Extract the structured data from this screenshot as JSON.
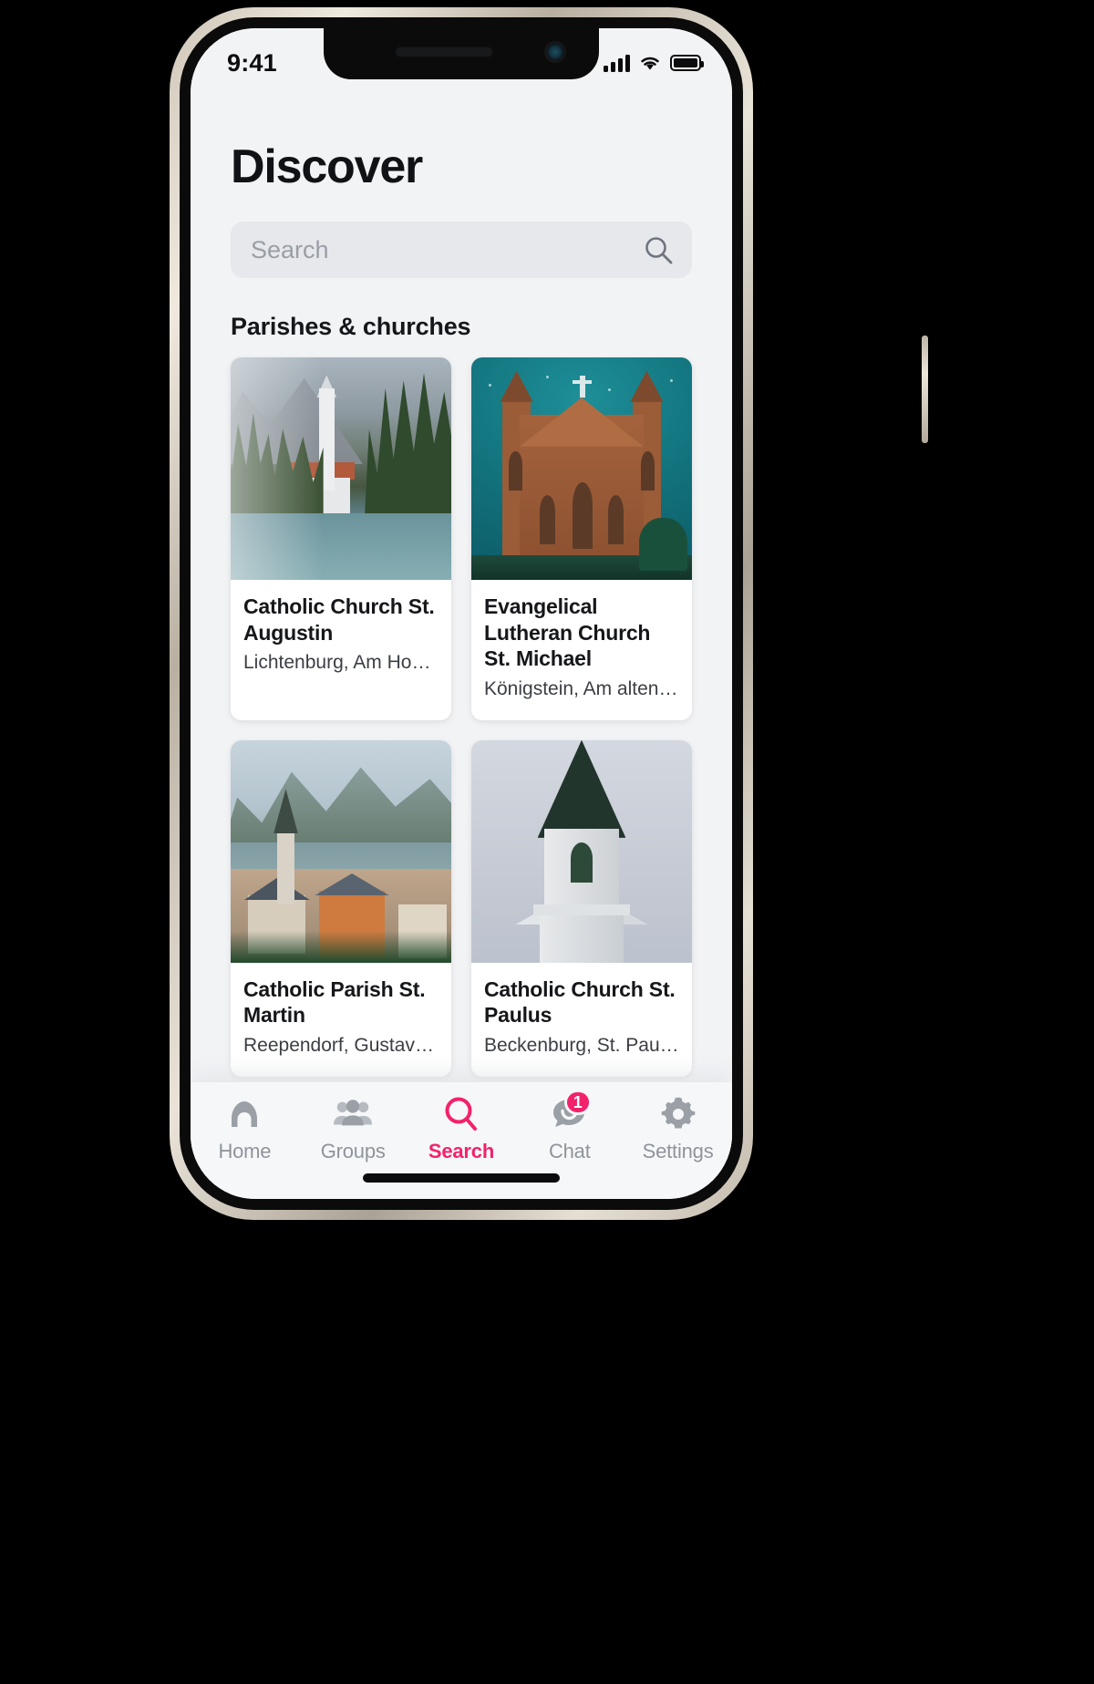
{
  "status_bar": {
    "time": "9:41",
    "signal_icon": "cellular-signal-icon",
    "wifi_icon": "wifi-icon",
    "battery_icon": "battery-full-icon"
  },
  "header": {
    "title": "Discover"
  },
  "search": {
    "value": "",
    "placeholder": "Search",
    "icon": "search-icon"
  },
  "sections": [
    {
      "title": "Parishes & churches",
      "cards": [
        {
          "title": "Catholic Church St. Augustin",
          "subtitle": "Lichtenburg, Am Hohenst…",
          "photo": "lake-church-photo"
        },
        {
          "title": "Evangelical Lutheran Church St. Michael",
          "subtitle": "Königstein, Am alten …",
          "photo": "gothic-church-photo"
        },
        {
          "title": "Catholic Parish St. Martin",
          "subtitle": "Reependorf, Gustav-…",
          "photo": "alpine-village-photo"
        },
        {
          "title": "Catholic Church St. Paulus",
          "subtitle": "Beckenburg, St. Paulus…",
          "photo": "white-steeple-photo"
        },
        {
          "title": "",
          "subtitle": "",
          "photo": "partial-card-photo-left"
        },
        {
          "title": "",
          "subtitle": "",
          "photo": "partial-card-photo-right"
        }
      ]
    }
  ],
  "tabbar": {
    "items": [
      {
        "label": "Home",
        "icon": "home-icon",
        "active": false,
        "badge": ""
      },
      {
        "label": "Groups",
        "icon": "groups-icon",
        "active": false,
        "badge": ""
      },
      {
        "label": "Search",
        "icon": "search-icon",
        "active": true,
        "badge": ""
      },
      {
        "label": "Chat",
        "icon": "chat-icon",
        "active": false,
        "badge": "1"
      },
      {
        "label": "Settings",
        "icon": "gear-icon",
        "active": false,
        "badge": ""
      }
    ]
  },
  "colors": {
    "accent": "#f2226b",
    "inactive": "#9aa0a6",
    "background": "#f2f3f5",
    "card": "#ffffff"
  }
}
